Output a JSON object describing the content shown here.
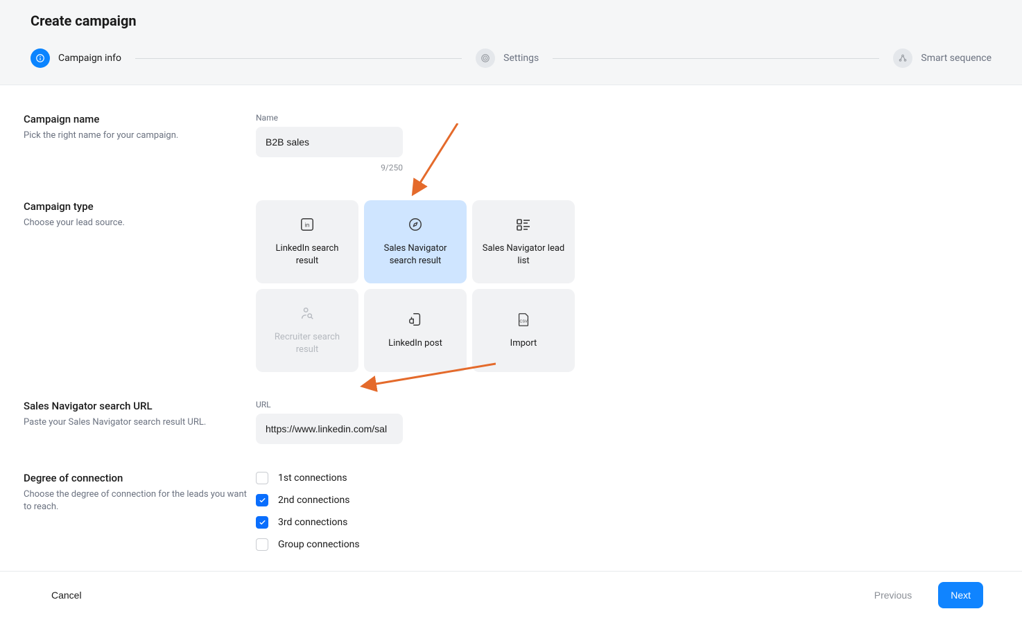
{
  "header": {
    "title": "Create campaign",
    "steps": [
      {
        "label": "Campaign info",
        "active": true
      },
      {
        "label": "Settings",
        "active": false
      },
      {
        "label": "Smart sequence",
        "active": false
      }
    ]
  },
  "sections": {
    "campaign_name": {
      "title": "Campaign name",
      "description": "Pick the right name for your campaign.",
      "field_label": "Name",
      "value": "B2B sales",
      "char_count": "9/250"
    },
    "campaign_type": {
      "title": "Campaign type",
      "description": "Choose your lead source.",
      "options": [
        {
          "label": "LinkedIn search result",
          "icon": "linkedin",
          "selected": false,
          "disabled": false
        },
        {
          "label": "Sales Navigator search result",
          "icon": "compass",
          "selected": true,
          "disabled": false
        },
        {
          "label": "Sales Navigator lead list",
          "icon": "list",
          "selected": false,
          "disabled": false
        },
        {
          "label": "Recruiter search result",
          "icon": "recruiter",
          "selected": false,
          "disabled": true
        },
        {
          "label": "LinkedIn post",
          "icon": "post",
          "selected": false,
          "disabled": false
        },
        {
          "label": "Import",
          "icon": "csv",
          "selected": false,
          "disabled": false
        }
      ]
    },
    "search_url": {
      "title": "Sales Navigator search URL",
      "description": "Paste your Sales Navigator search result URL.",
      "field_label": "URL",
      "value": "https://www.linkedin.com/sal"
    },
    "degree": {
      "title": "Degree of connection",
      "description": "Choose the degree of connection for the leads you want to reach.",
      "options": [
        {
          "label": "1st connections",
          "checked": false
        },
        {
          "label": "2nd connections",
          "checked": true
        },
        {
          "label": "3rd connections",
          "checked": true
        },
        {
          "label": "Group connections",
          "checked": false
        }
      ]
    }
  },
  "footer": {
    "cancel": "Cancel",
    "previous": "Previous",
    "next": "Next"
  }
}
